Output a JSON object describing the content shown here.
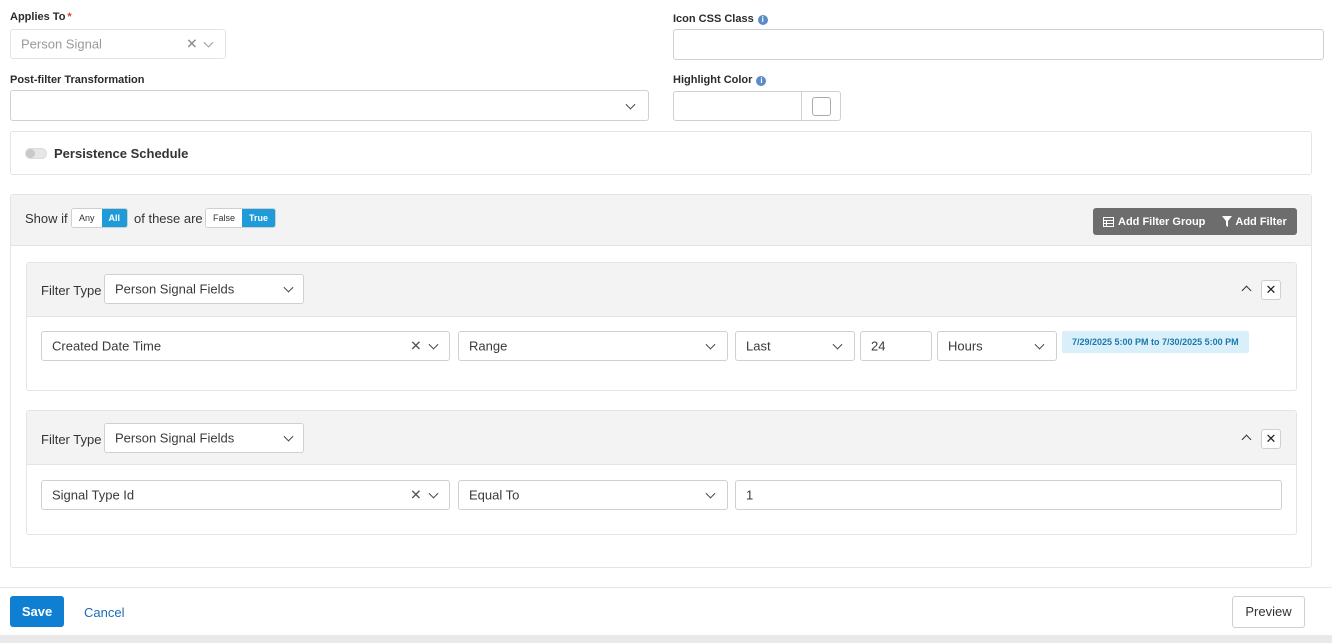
{
  "form": {
    "applies_to": {
      "label": "Applies To",
      "required_mark": "*",
      "value": "Person Signal"
    },
    "icon_css_class": {
      "label": "Icon CSS Class",
      "value": ""
    },
    "post_filter": {
      "label": "Post-filter Transformation",
      "value": ""
    },
    "highlight_color": {
      "label": "Highlight Color",
      "value": ""
    },
    "persistence": {
      "label": "Persistence Schedule",
      "enabled": false
    }
  },
  "filters": {
    "show_if_label": "Show if",
    "any_label": "Any",
    "all_label": "All",
    "of_these_label": "of these are",
    "false_label": "False",
    "true_label": "True",
    "selected_scope": "All",
    "selected_truth": "True",
    "add_group_label": "Add Filter Group",
    "add_filter_label": "Add Filter",
    "groups": [
      {
        "filter_type_label": "Filter Type",
        "filter_type_value": "Person Signal Fields",
        "field": "Created Date Time",
        "comparison": "Range",
        "range_mode": "Last",
        "amount": "24",
        "unit": "Hours",
        "range_preview": "7/29/2025 5:00 PM to 7/30/2025 5:00 PM"
      },
      {
        "filter_type_label": "Filter Type",
        "filter_type_value": "Person Signal Fields",
        "field": "Signal Type Id",
        "comparison": "Equal To",
        "value": "1"
      }
    ]
  },
  "footer": {
    "save_label": "Save",
    "cancel_label": "Cancel",
    "preview_label": "Preview"
  },
  "colors": {
    "accent": "#1e9bd8",
    "primary_button": "#0f7fd1",
    "link": "#1a6bb5",
    "range_badge_bg": "#d9f0fa",
    "range_badge_text": "#1b79ab"
  },
  "icons": {
    "info": "info-icon",
    "clear": "clear-icon",
    "dropdown": "chevron-down-icon",
    "collapse": "chevron-up-icon",
    "close": "close-icon",
    "table": "table-icon",
    "funnel": "funnel-icon"
  }
}
